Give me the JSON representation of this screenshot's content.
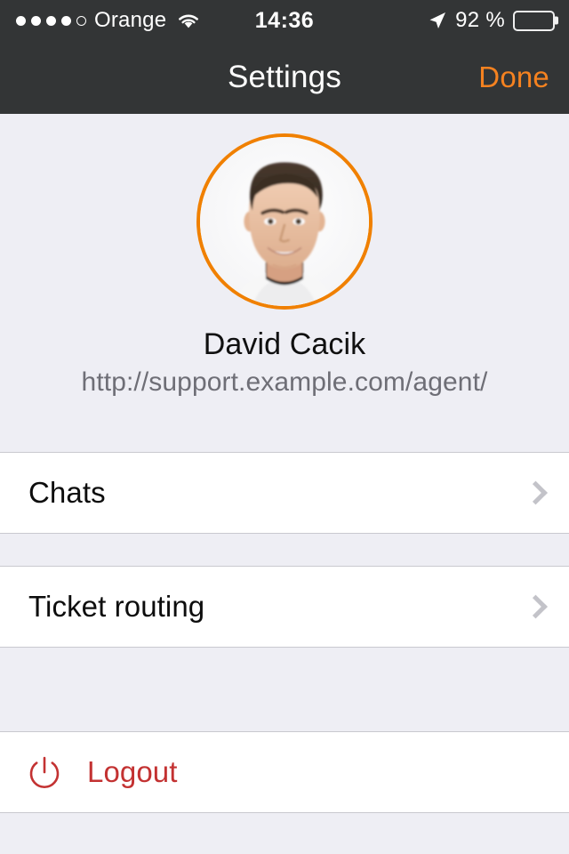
{
  "statusbar": {
    "signal_dots_filled": 4,
    "signal_dots_total": 5,
    "carrier": "Orange",
    "wifi_icon": "wifi-icon",
    "time": "14:36",
    "location_icon": "location-arrow-icon",
    "battery_percent": "92 %",
    "battery_icon": "battery-icon"
  },
  "navbar": {
    "title": "Settings",
    "done_label": "Done"
  },
  "profile": {
    "avatar_icon": "avatar-photo",
    "name": "David Cacik",
    "url": "http://support.example.com/agent/",
    "border_color": "#f08000"
  },
  "rows": [
    {
      "label": "Chats",
      "accessory": "chevron-right-icon"
    },
    {
      "label": "Ticket routing",
      "accessory": "chevron-right-icon"
    },
    {
      "label": "Logout",
      "icon": "power-icon",
      "color": "#c33232"
    }
  ],
  "colors": {
    "navbar_bg": "#333536",
    "accent_orange": "#f58220",
    "page_bg": "#eeeef4",
    "row_bg": "#ffffff",
    "separator": "#c9c9cf",
    "danger": "#c33232",
    "chevron": "#c3c3c9"
  }
}
